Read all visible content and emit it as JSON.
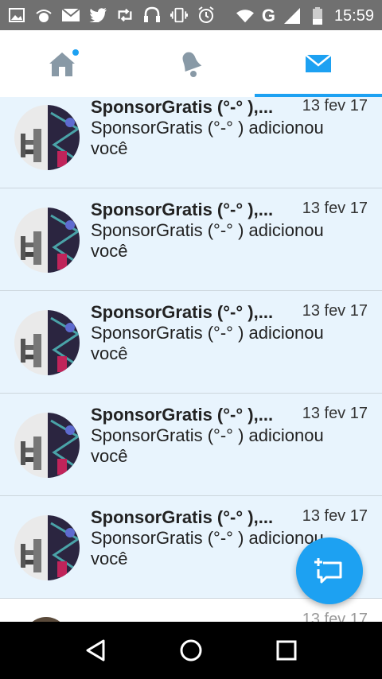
{
  "status_bar": {
    "time": "15:59",
    "network": "G",
    "icons": [
      "image-icon",
      "radio-icon",
      "mail-icon",
      "twitter-icon",
      "retweet-icon",
      "headset-icon",
      "vibrate-icon",
      "alarm-icon",
      "wifi-icon",
      "signal-icon",
      "battery-icon"
    ]
  },
  "tabs": [
    {
      "name": "home",
      "icon": "home-icon",
      "has_badge": true
    },
    {
      "name": "notifications",
      "icon": "bell-icon"
    },
    {
      "name": "messages",
      "icon": "envelope-icon",
      "active": true
    }
  ],
  "colors": {
    "accent": "#1da1f2",
    "row_bg": "#e8f4fd",
    "status_bar": "#707070"
  },
  "conversations": [
    {
      "name": "SponsorGratis (°-° ),...",
      "date": "13 fev 17",
      "text": "SponsorGratis (°-° ) adicionou você"
    },
    {
      "name": "SponsorGratis (°-° ),...",
      "date": "13 fev 17",
      "text": "SponsorGratis (°-° ) adicionou você"
    },
    {
      "name": "SponsorGratis (°-° ),...",
      "date": "13 fev 17",
      "text": "SponsorGratis (°-° ) adicionou você"
    },
    {
      "name": "SponsorGratis (°-° ),...",
      "date": "13 fev 17",
      "text": "SponsorGratis (°-° ) adicionou você"
    },
    {
      "name": "SponsorGratis (°-° ),...",
      "date": "13 fev 17",
      "text": "SponsorGratis (°-° ) adicionou você"
    }
  ],
  "partial_conversation": {
    "name": "...",
    "date": "13 fev 17"
  },
  "fab": {
    "icon": "new-message-icon"
  },
  "nav_bar": {
    "icons": [
      "back-icon",
      "home-circle-icon",
      "recents-icon"
    ]
  }
}
